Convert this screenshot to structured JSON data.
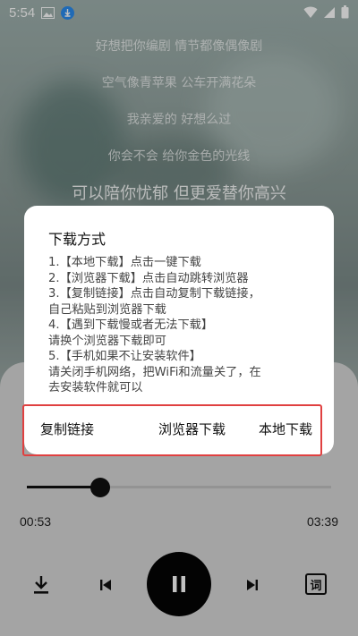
{
  "status_bar": {
    "time": "5:54"
  },
  "lyrics": [
    "好想把你编剧 情节都像偶像剧",
    "空气像青苹果 公车开满花朵",
    "我亲爱的 好想么过",
    "你会不会 给你金色的光线",
    "可以陪你忧郁 但更爱替你高兴"
  ],
  "dialog": {
    "title": "下载方式",
    "lines": [
      "1.【本地下载】点击一键下载",
      "2.【浏览器下载】点击自动跳转浏览器",
      "3.【复制链接】点击自动复制下载链接，",
      "自己粘贴到浏览器下载",
      "4.【遇到下载慢或者无法下载】",
      "请换个浏览器下载即可",
      "5.【手机如果不让安装软件】",
      "请关闭手机网络，把WiFi和流量关了，在",
      "去安装软件就可以"
    ],
    "buttons": {
      "copy": "复制链接",
      "browser": "浏览器下载",
      "local": "本地下载"
    },
    "highlight_color": "#e04040"
  },
  "player": {
    "current_time": "00:53",
    "total_time": "03:39",
    "progress": 0.24,
    "lyrics_button": "词"
  }
}
